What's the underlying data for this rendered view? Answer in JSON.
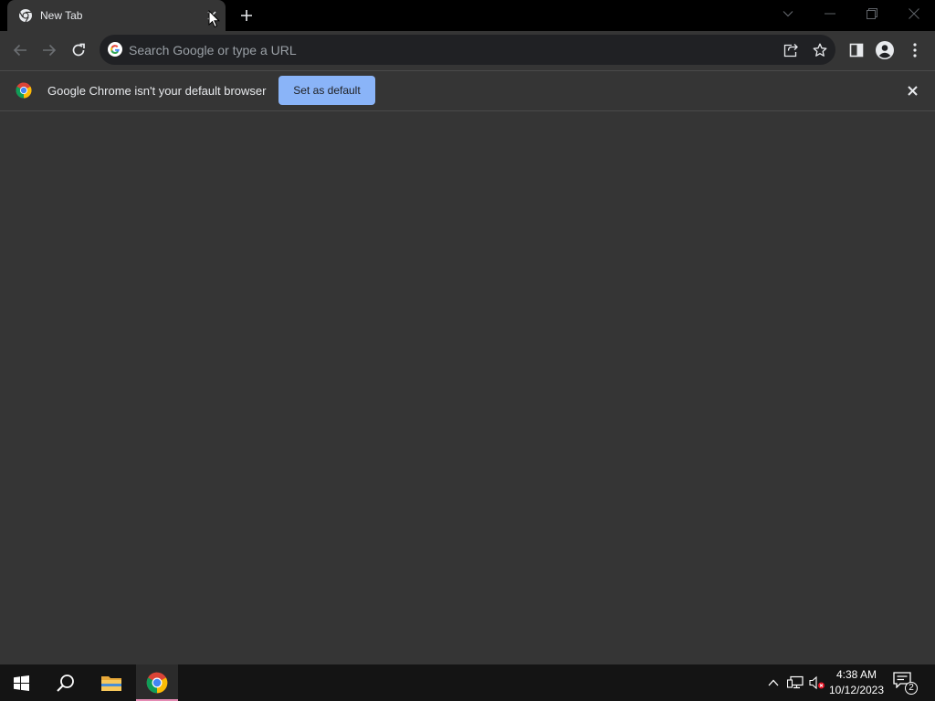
{
  "tab": {
    "title": "New Tab",
    "favicon": "chrome-icon"
  },
  "toolbar": {
    "omnibox_placeholder": "Search Google or type a URL"
  },
  "infobar": {
    "message": "Google Chrome isn't your default browser",
    "set_default_label": "Set as default"
  },
  "taskbar": {
    "time": "4:38 AM",
    "date": "10/12/2023",
    "notification_count": "2"
  },
  "colors": {
    "tab_strip": "#000000",
    "toolbar": "#353535",
    "omnibox": "#202124",
    "accent_button": "#8ab4f8",
    "text": "#e8eaed",
    "taskbar": "#141414"
  }
}
